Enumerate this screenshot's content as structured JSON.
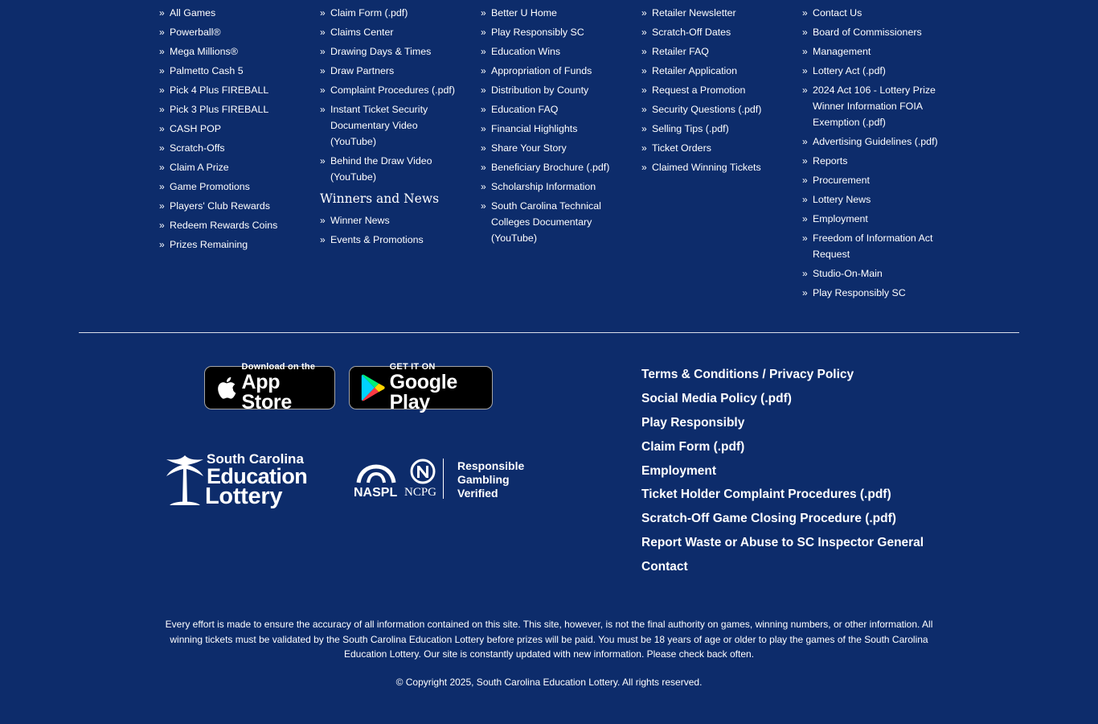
{
  "columns": [
    {
      "items": [
        "All Games",
        "Powerball®",
        "Mega Millions®",
        "Palmetto Cash 5",
        "Pick 4 Plus FIREBALL",
        "Pick 3 Plus FIREBALL",
        "CASH POP",
        "Scratch-Offs",
        "Claim A Prize",
        "Game Promotions",
        "Players' Club Rewards",
        "Redeem Rewards Coins",
        "Prizes Remaining"
      ]
    },
    {
      "items": [
        "Claim Form (.pdf)",
        "Claims Center",
        "Drawing Days & Times",
        "Draw Partners",
        "Complaint Procedures (.pdf)",
        "Instant Ticket Security Documentary Video (YouTube)",
        "Behind the Draw Video (YouTube)"
      ],
      "heading": "Winners and News",
      "items2": [
        "Winner News",
        "Events & Promotions"
      ]
    },
    {
      "items": [
        "Better U Home",
        "Play Responsibly SC",
        "Education Wins",
        "Appropriation of Funds",
        "Distribution by County",
        "Education FAQ",
        "Financial Highlights",
        "Share Your Story",
        "Beneficiary Brochure (.pdf)",
        "Scholarship Information",
        "South Carolina Technical Colleges Documentary (YouTube)"
      ]
    },
    {
      "items": [
        "Retailer Newsletter",
        "Scratch-Off Dates",
        "Retailer FAQ",
        "Retailer Application",
        "Request a Promotion",
        "Security Questions (.pdf)",
        "Selling Tips (.pdf)",
        "Ticket Orders",
        "Claimed Winning Tickets"
      ]
    },
    {
      "items": [
        "Contact Us",
        "Board of Commissioners",
        "Management",
        "Lottery Act (.pdf)",
        "2024 Act 106 - Lottery Prize Winner Information FOIA Exemption (.pdf)",
        "Advertising Guidelines (.pdf)",
        "Reports",
        "Procurement",
        "Lottery News",
        "Employment",
        "Freedom of Information Act Request",
        "Studio-On-Main",
        "Play Responsibly SC"
      ]
    }
  ],
  "stores": {
    "appstore": {
      "small": "Download on the",
      "big": "App Store",
      "icon": "apple-icon"
    },
    "googleplay": {
      "small": "GET IT ON",
      "big": "Google Play",
      "icon": "google-play-icon"
    }
  },
  "logos": {
    "sc": {
      "line1": "South Carolina",
      "line2": "Education",
      "line3": "Lottery"
    },
    "naspl": {
      "naspl": "NASPL",
      "ncpg": "NCPG",
      "rg1": "Responsible",
      "rg2": "Gambling",
      "rg3": "Verified"
    }
  },
  "footer_links": [
    "Terms & Conditions / Privacy Policy",
    "Social Media Policy (.pdf)",
    "Play Responsibly",
    "Claim Form (.pdf)",
    "Employment",
    "Ticket Holder Complaint Procedures (.pdf)",
    "Scratch-Off Game Closing Procedure (.pdf)",
    "Report Waste or Abuse to SC Inspector General",
    "Contact"
  ],
  "disclaimer": "Every effort is made to ensure the accuracy of all information contained on this site. This site, however, is not the final authority on games, winning numbers, or other information. All winning tickets must be validated by the South Carolina Education Lottery before prizes will be paid. You must be 18 years of age or older to play the games of the South Carolina Education Lottery. Our site is constantly updated with new information. Please check back often.",
  "copyright": "© Copyright 2025, South Carolina Education Lottery. All rights reserved.",
  "colors": {
    "background": "#0d2c6b",
    "text": "#ffffff"
  }
}
